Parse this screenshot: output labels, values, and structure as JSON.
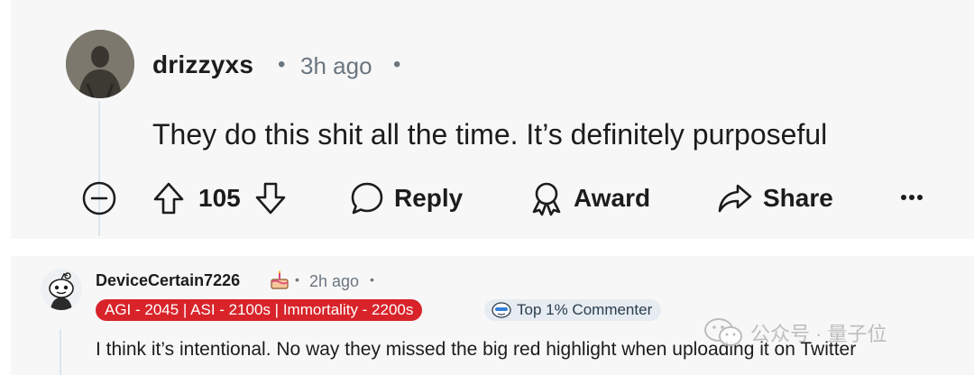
{
  "comment_top": {
    "username": "drizzyxs",
    "separator": "•",
    "time": "3h ago",
    "body": "They do this shit all the time. It’s definitely purposeful",
    "actions": {
      "vote_count": "105",
      "reply_label": "Reply",
      "award_label": "Award",
      "share_label": "Share",
      "more_label": "•••"
    }
  },
  "comment_bottom": {
    "username": "DeviceCertain7226",
    "separator": "•",
    "time": "2h ago",
    "flair": "AGI - 2045 | ASI - 2100s | Immortality - 2200s",
    "badge": "Top 1% Commenter",
    "body": "I think it’s intentional. No way they missed the big red highlight when uploading it on Twitter"
  },
  "watermark": {
    "text": "公众号 · 量子位"
  },
  "colors": {
    "card_bg": "#f7f7f7",
    "thread_line": "#dbe6ee",
    "flair_red": "#d8232a",
    "badge_bg": "#e6ecf1",
    "meta_gray": "#6b7680"
  }
}
